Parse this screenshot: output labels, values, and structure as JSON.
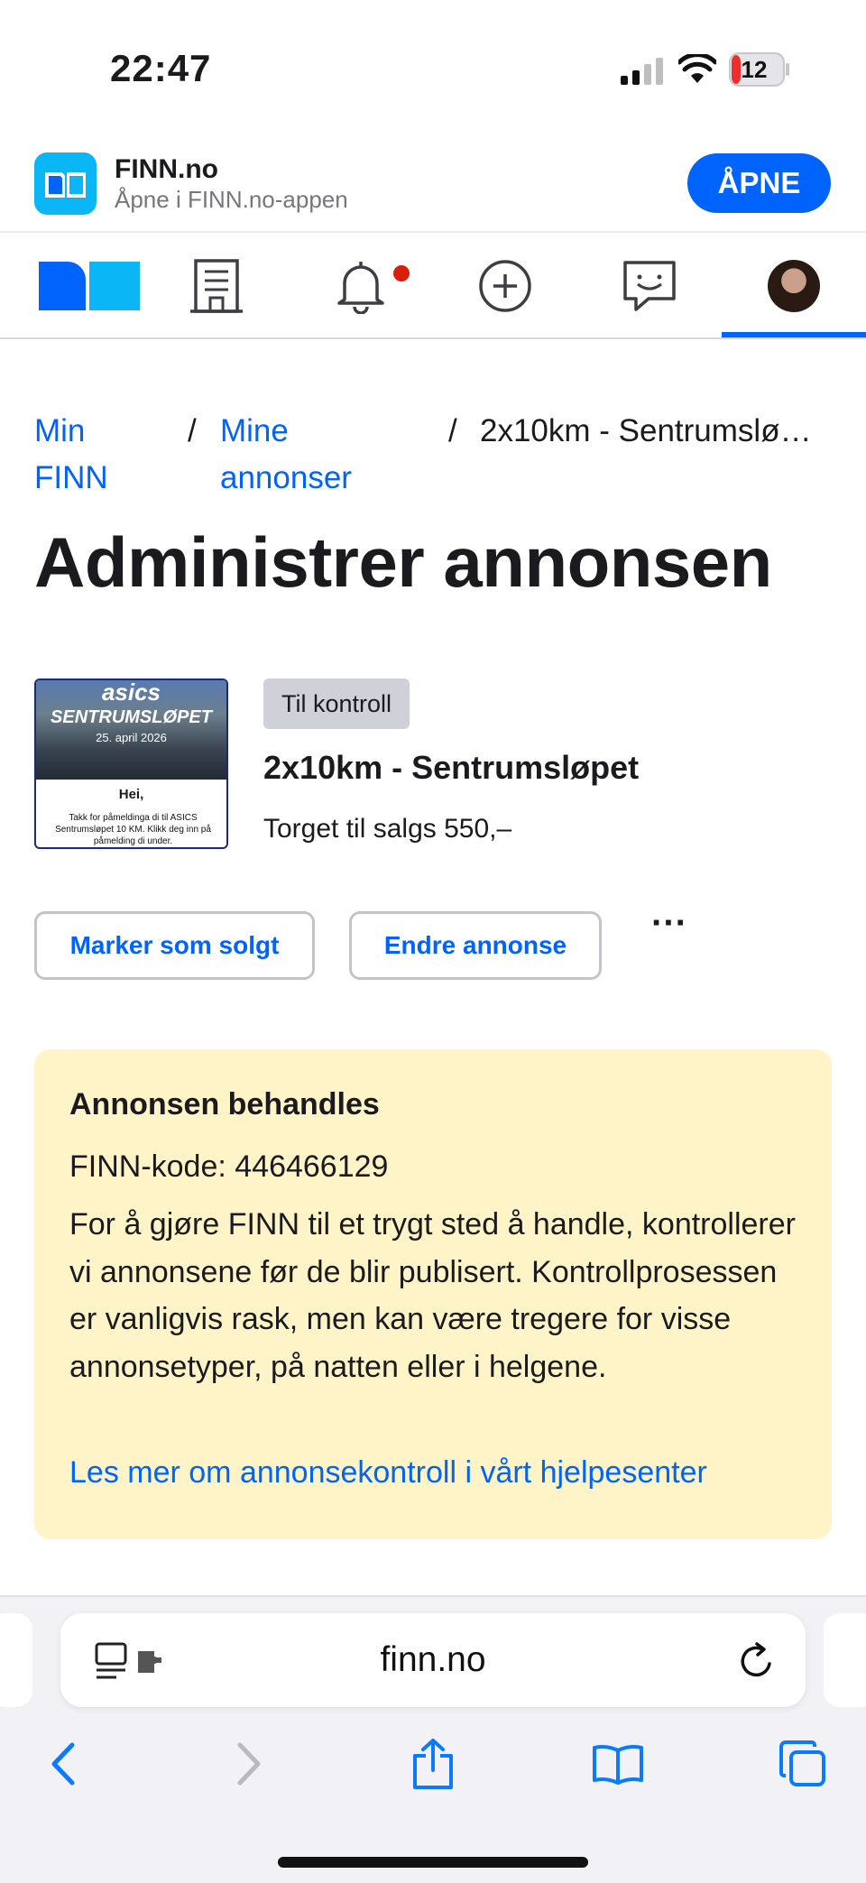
{
  "status_bar": {
    "time": "22:47",
    "battery": "12"
  },
  "app_banner": {
    "app_name": "FINN.no",
    "subtitle": "Åpne i FINN.no-appen",
    "open_label": "ÅPNE"
  },
  "nav": {
    "items": [
      "finn-logo",
      "building-icon",
      "bell-icon",
      "plus-icon",
      "chat-icon",
      "avatar"
    ],
    "notification_dot": true,
    "active": "avatar"
  },
  "breadcrumb": {
    "item1": "Min FINN",
    "item2": "Mine annonser",
    "current": "2x10km - Sentrumsløpet",
    "current_display": "2x10km - Sentrumslø…",
    "separator": "/"
  },
  "page_title": "Administrer annonsen",
  "ad": {
    "thumbnail": {
      "brand": "asics",
      "headline": "SENTRUMSLØPET",
      "date": "25. april 2026",
      "greeting": "Hei,",
      "text": "Takk for påmeldinga di til ASICS Sentrumsløpet 10 KM. Klikk deg inn på påmelding di under."
    },
    "status_badge": "Til kontroll",
    "title": "2x10km - Sentrumsløpet",
    "price": "Torget til salgs 550,–"
  },
  "actions": {
    "mark_sold": "Marker som solgt",
    "edit_ad": "Endre annonse",
    "more": "···"
  },
  "notice": {
    "title": "Annonsen behandles",
    "finn_code": "FINN-kode: 446466129",
    "body": "For å gjøre FINN til et trygt sted å handle, kontrollerer vi annonsene før de blir publisert. Kontrollprosessen er vanligvis rask, men kan være tregere for visse annonsetyper, på natten eller i helgene.",
    "link": "Les mer om annonsekontroll i vårt hjelpesenter"
  },
  "browser": {
    "url": "finn.no",
    "toolbar": [
      "back-icon",
      "forward-icon",
      "share-icon",
      "bookmarks-icon",
      "tabs-icon"
    ]
  },
  "colors": {
    "accent": "#0063fb",
    "notice_bg": "#fff4c7",
    "notification": "#d91f0a"
  }
}
